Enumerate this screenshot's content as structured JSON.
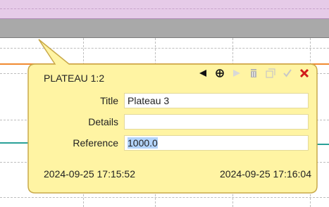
{
  "popup": {
    "title": "PLATEAU 1:2",
    "toolbar": {
      "prev_icon": "triangle-left-icon",
      "target_icon": "crosshair-icon",
      "next_icon": "triangle-right-icon",
      "delete_icon": "trash-icon",
      "copy_icon": "copy-icon",
      "confirm_icon": "check-icon",
      "close_icon": "close-icon"
    },
    "fields": {
      "title_label": "Title",
      "title_value": "Plateau 3",
      "details_label": "Details",
      "details_value": "",
      "reference_label": "Reference",
      "reference_value": "1000.0"
    },
    "start_time": "2024-09-25 17:15:52",
    "end_time": "2024-09-25 17:16:04"
  },
  "colors": {
    "callout_fill": "#fff4a3",
    "callout_border": "#c9a94a",
    "band_purple": "#e6cbe8",
    "band_gray": "#a9a9a9",
    "trace_orange": "#f08a30",
    "trace_teal": "#2aa198",
    "close_red": "#d11a1a"
  }
}
